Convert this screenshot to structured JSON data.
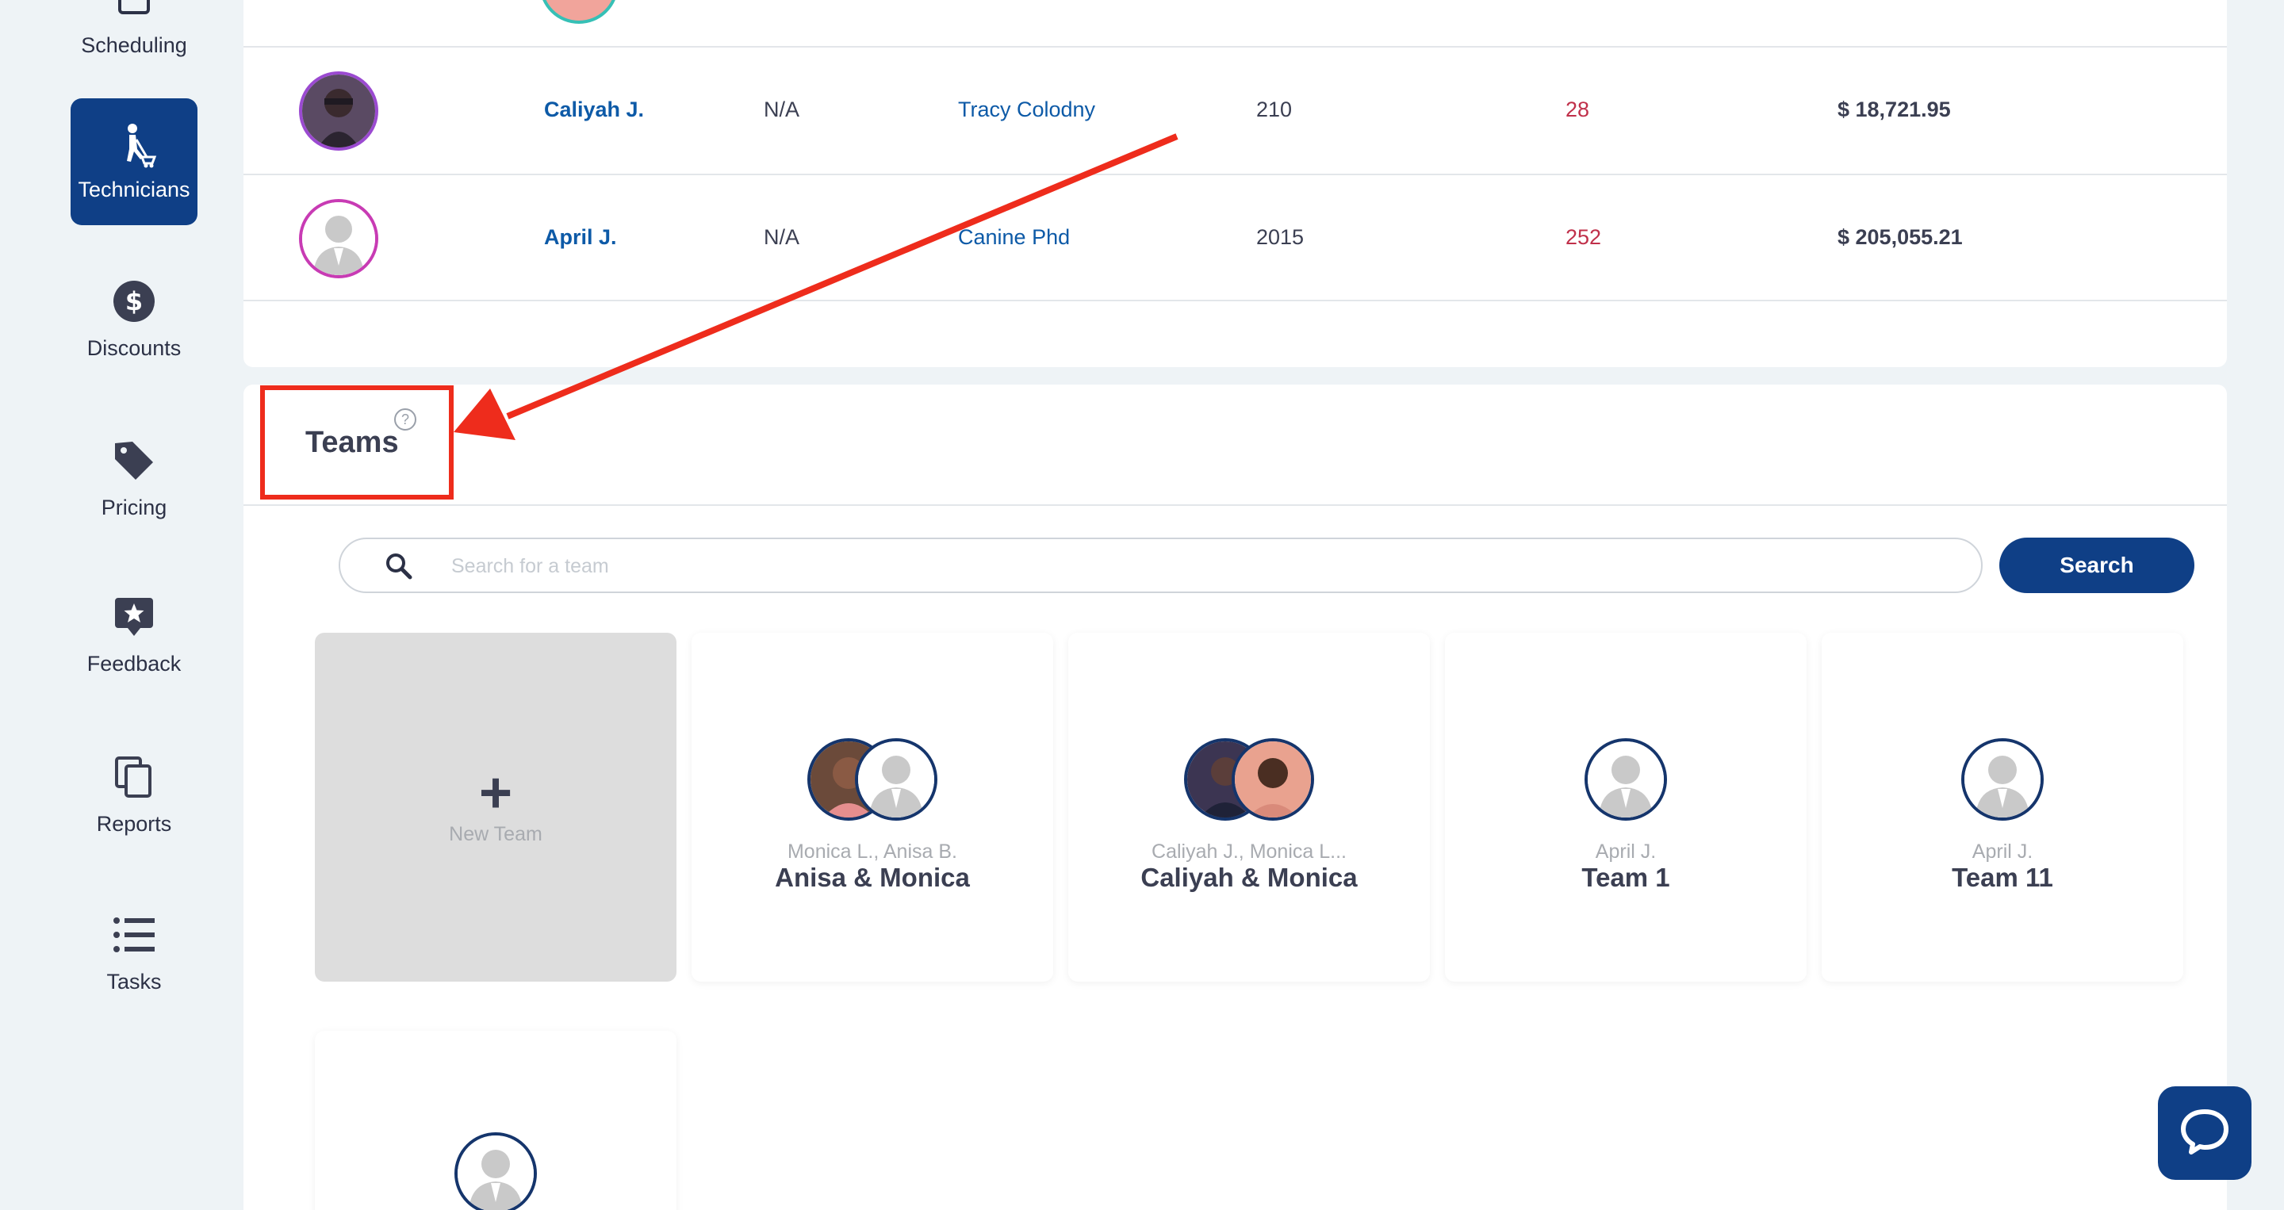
{
  "sidebar": {
    "items": [
      {
        "label": "Scheduling",
        "icon": "calendar-icon"
      },
      {
        "label": "Technicians",
        "icon": "technician-icon",
        "active": true
      },
      {
        "label": "Discounts",
        "icon": "dollar-circle-icon"
      },
      {
        "label": "Pricing",
        "icon": "tag-icon"
      },
      {
        "label": "Feedback",
        "icon": "star-badge-icon"
      },
      {
        "label": "Reports",
        "icon": "copy-icon"
      },
      {
        "label": "Tasks",
        "icon": "list-icon"
      }
    ]
  },
  "technicians": {
    "rows": [
      {
        "name": "Caliyah J.",
        "col2": "N/A",
        "client": "Tracy Colodny",
        "num1": "210",
        "num2": "28",
        "amount": "$ 18,721.95"
      },
      {
        "name": "April J.",
        "col2": "N/A",
        "client": "Canine Phd",
        "num1": "2015",
        "num2": "252",
        "amount": "$ 205,055.21"
      }
    ]
  },
  "teams": {
    "title": "Teams",
    "help": "?",
    "search": {
      "placeholder": "Search for a team",
      "value": "",
      "button": "Search"
    },
    "new_team": {
      "plus": "+",
      "label": "New Team"
    },
    "cards": [
      {
        "members": "Monica L., Anisa B.",
        "name": "Anisa & Monica"
      },
      {
        "members": "Caliyah J., Monica L...",
        "name": "Caliyah & Monica"
      },
      {
        "members": "April J.",
        "name": "Team 1"
      },
      {
        "members": "April J.",
        "name": "Team 11"
      }
    ]
  },
  "colors": {
    "accent": "#0f3f86",
    "link": "#0d5aa7",
    "negative": "#c0304a",
    "annotation": "#ee2c1c"
  }
}
